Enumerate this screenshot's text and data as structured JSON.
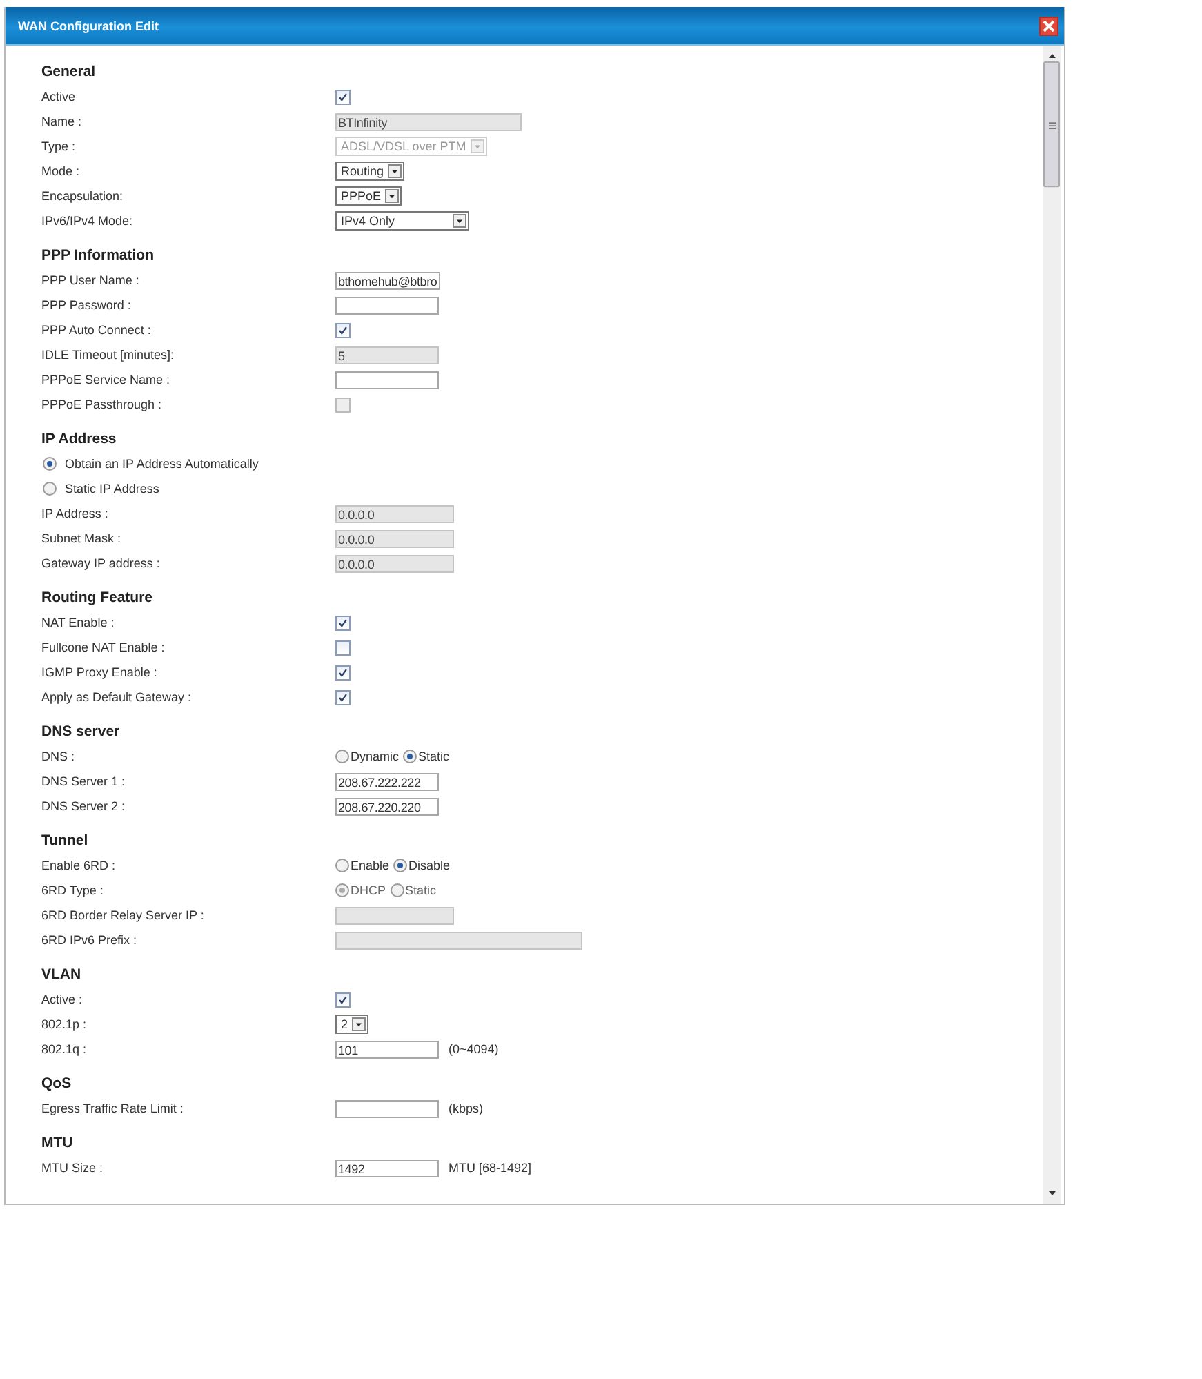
{
  "window": {
    "title": "WAN Configuration Edit"
  },
  "sections": [
    {
      "heading": "General",
      "rows": [
        {
          "kind": "checkbox",
          "label": "Active",
          "checked": true,
          "disabled": false
        },
        {
          "kind": "wide-field",
          "label": "Name :",
          "value": "BTInfinity",
          "disabled": true
        },
        {
          "kind": "select",
          "label": "Type :",
          "value": "ADSL/VDSL over PTM",
          "disabled": true
        },
        {
          "kind": "select",
          "label": "Mode :",
          "value": "Routing",
          "disabled": false
        },
        {
          "kind": "select",
          "label": "Encapsulation:",
          "value": "PPPoE",
          "disabled": false
        },
        {
          "kind": "wide-select",
          "label": "IPv6/IPv4 Mode:",
          "value": "IPv4 Only",
          "disabled": false
        }
      ]
    },
    {
      "heading": "PPP Information",
      "rows": [
        {
          "kind": "field",
          "label": "PPP User Name :",
          "value": "bthomehub@btbro",
          "disabled": false
        },
        {
          "kind": "field",
          "label": "PPP Password :",
          "disabled": false
        },
        {
          "kind": "checkbox",
          "label": "PPP Auto Connect :",
          "checked": true,
          "disabled": false
        },
        {
          "kind": "field",
          "label": "IDLE Timeout [minutes]:",
          "value": "5",
          "disabled": true
        },
        {
          "kind": "field",
          "label": "PPPoE Service Name :",
          "disabled": false
        },
        {
          "kind": "checkbox",
          "label": "PPPoE Passthrough :",
          "checked": false,
          "disabled": true
        }
      ]
    },
    {
      "heading": "IP Address",
      "rows": [
        {
          "kind": "radio",
          "label": "Obtain an IP Address Automatically",
          "selected": true
        },
        {
          "kind": "radio",
          "label": "Static IP Address",
          "selected": false
        },
        {
          "kind": "ip-field",
          "label": "IP Address :",
          "value": "0.0.0.0",
          "disabled": true
        },
        {
          "kind": "ip-field",
          "label": "Subnet Mask :",
          "value": "0.0.0.0",
          "disabled": true
        },
        {
          "kind": "ip-field",
          "label": "Gateway IP address :",
          "value": "0.0.0.0",
          "disabled": true
        }
      ]
    },
    {
      "heading": "Routing Feature",
      "rows": [
        {
          "kind": "checkbox",
          "label": "NAT Enable :",
          "checked": true,
          "disabled": false
        },
        {
          "kind": "checkbox",
          "label": "Fullcone NAT Enable :",
          "checked": false,
          "disabled": false
        },
        {
          "kind": "checkbox",
          "label": "IGMP Proxy Enable :",
          "checked": true,
          "disabled": false
        },
        {
          "kind": "checkbox",
          "label": "Apply as Default Gateway :",
          "checked": true,
          "disabled": false
        }
      ]
    },
    {
      "heading": "DNS server",
      "rows": [
        {
          "kind": "radio-group",
          "label": "DNS :",
          "disabled": false,
          "options": [
            {
              "label": "Dynamic",
              "selected": false
            },
            {
              "label": "Static",
              "selected": true
            }
          ]
        },
        {
          "kind": "field",
          "label": "DNS Server 1 :",
          "value": "208.67.222.222",
          "disabled": false
        },
        {
          "kind": "field",
          "label": "DNS Server 2 :",
          "value": "208.67.220.220",
          "disabled": false
        }
      ]
    },
    {
      "heading": "Tunnel",
      "rows": [
        {
          "kind": "radio-group",
          "label": "Enable 6RD :",
          "disabled": false,
          "options": [
            {
              "label": "Enable",
              "selected": false
            },
            {
              "label": "Disable",
              "selected": true
            }
          ]
        },
        {
          "kind": "radio-group",
          "label": "6RD Type :",
          "disabled": true,
          "options": [
            {
              "label": "DHCP",
              "selected": true
            },
            {
              "label": "Static",
              "selected": false
            }
          ]
        },
        {
          "kind": "ip-field",
          "label": "6RD Border Relay Server IP :",
          "disabled": true
        },
        {
          "kind": "long-field",
          "label": "6RD IPv6 Prefix :",
          "disabled": true
        }
      ]
    },
    {
      "heading": "VLAN",
      "rows": [
        {
          "kind": "checkbox",
          "label": "Active :",
          "checked": true,
          "disabled": false
        },
        {
          "kind": "select",
          "label": "802.1p :",
          "value": "2",
          "disabled": false
        },
        {
          "kind": "field",
          "label": "802.1q :",
          "value": "101",
          "unit": "(0~4094)",
          "disabled": false
        }
      ]
    },
    {
      "heading": "QoS",
      "rows": [
        {
          "kind": "field",
          "label": "Egress Traffic Rate Limit :",
          "unit": "(kbps)",
          "disabled": false
        }
      ]
    },
    {
      "heading": "MTU",
      "rows": [
        {
          "kind": "field",
          "label": "MTU Size :",
          "value": "1492",
          "unit": "MTU [68-1492]",
          "disabled": false
        }
      ]
    }
  ]
}
